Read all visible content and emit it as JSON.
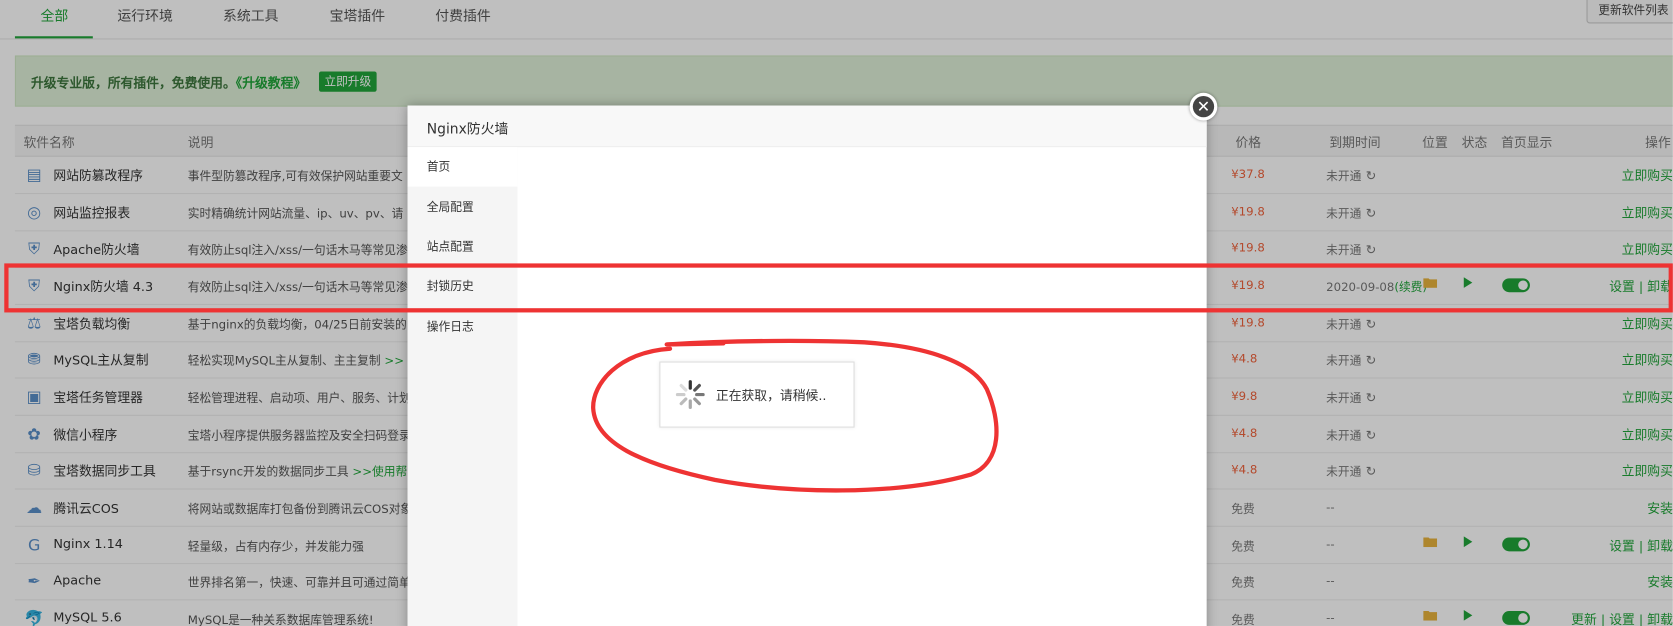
{
  "tabs": [
    "全部",
    "运行环境",
    "系统工具",
    "宝塔插件",
    "付费插件"
  ],
  "update_list_button": "更新软件列表",
  "banner": {
    "text": "升级专业版，所有插件，免费使用。",
    "link": "《升级教程》",
    "button": "立即升级"
  },
  "table_headers": {
    "name": "软件名称",
    "desc": "说明",
    "price": "价格",
    "expire": "到期时间",
    "location": "位置",
    "status": "状态",
    "home": "首页显示",
    "ops": "操作"
  },
  "rows": [
    {
      "name": "网站防篡改程序",
      "desc": "事件型防篡改程序,可有效保护网站重要文",
      "desc_link": "",
      "price": "¥37.8",
      "expire": "未开通",
      "renew": "",
      "op": "立即购买",
      "icon": "tamper-icon"
    },
    {
      "name": "网站监控报表",
      "desc": "实时精确统计网站流量、ip、uv、pv、请",
      "desc_link": "",
      "price": "¥19.8",
      "expire": "未开通",
      "renew": "",
      "op": "立即购买",
      "icon": "monitor-icon"
    },
    {
      "name": "Apache防火墙",
      "desc": "有效防止sql注入/xss/一句话木马等常见渗",
      "desc_link": "",
      "price": "¥19.8",
      "expire": "未开通",
      "renew": "",
      "op": "立即购买",
      "icon": "waf-icon"
    },
    {
      "name": "Nginx防火墙 4.3",
      "desc": "有效防止sql注入/xss/一句话木马等常见渗",
      "desc_link": "",
      "price": "¥19.8",
      "expire": "2020-09-08",
      "renew": "(续费)",
      "op": "设置 | 卸载",
      "icon": "waf-icon"
    },
    {
      "name": "宝塔负载均衡",
      "desc": "基于nginx的负载均衡，04/25日前安装的",
      "desc_link": "",
      "price": "¥19.8",
      "expire": "未开通",
      "renew": "",
      "op": "立即购买",
      "icon": "balance-icon"
    },
    {
      "name": "MySQL主从复制",
      "desc": "轻松实现MySQL主从复制、主主复制 ",
      "desc_link": ">>",
      "price": "¥4.8",
      "expire": "未开通",
      "renew": "",
      "op": "立即购买",
      "icon": "mysql-replica-icon"
    },
    {
      "name": "宝塔任务管理器",
      "desc": "轻松管理进程、启动项、用户、服务、计划",
      "desc_link": "",
      "price": "¥9.8",
      "expire": "未开通",
      "renew": "",
      "op": "立即购买",
      "icon": "task-manager-icon"
    },
    {
      "name": "微信小程序",
      "desc": "宝塔小程序提供服务器监控及安全扫码登录",
      "desc_link": "",
      "price": "¥4.8",
      "expire": "未开通",
      "renew": "",
      "op": "立即购买",
      "icon": "wechat-mini-icon"
    },
    {
      "name": "宝塔数据同步工具",
      "desc": "基于rsync开发的数据同步工具 ",
      "desc_link": ">>使用帮助",
      "price": "¥4.8",
      "expire": "未开通",
      "renew": "",
      "op": "立即购买",
      "icon": "database-sync-icon"
    },
    {
      "name": "腾讯云COS",
      "desc": "将网站或数据库打包备份到腾讯云COS对象存储",
      "desc_link": "",
      "price": "免费",
      "expire": "--",
      "renew": "",
      "op": "安装",
      "icon": "tencent-cloud-icon"
    },
    {
      "name": "Nginx 1.14",
      "desc": "轻量级，占有内存少，并发能力强",
      "desc_link": "",
      "price": "免费",
      "expire": "--",
      "renew": "",
      "op": "设置 | 卸载",
      "icon": "nginx-icon"
    },
    {
      "name": "Apache",
      "desc": "世界排名第一，快速、可靠并且可通过简单",
      "desc_link": "",
      "price": "免费",
      "expire": "--",
      "renew": "",
      "op": "安装",
      "icon": "apache-icon"
    },
    {
      "name": "MySQL 5.6",
      "desc": "MySQL是一种关系数据库管理系统!",
      "desc_link": "",
      "price": "免费",
      "expire": "--",
      "renew": "",
      "op": "更新 | 设置 | 卸载",
      "icon": "mysql-icon"
    }
  ],
  "modal": {
    "title": "Nginx防火墙",
    "nav": [
      "首页",
      "全局配置",
      "站点配置",
      "封锁历史",
      "操作日志"
    ],
    "loading_text": "正在获取，请稍候.."
  },
  "colors": {
    "accent": "#20a53a",
    "price": "#f0633c",
    "annotation": "#ee3333"
  }
}
